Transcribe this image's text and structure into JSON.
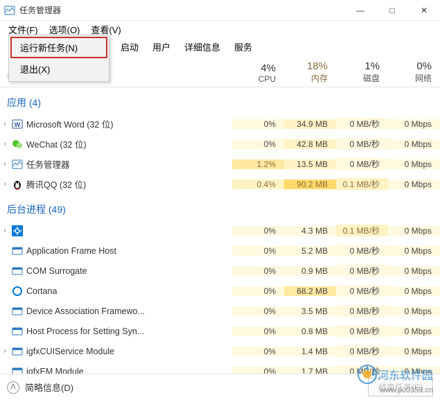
{
  "window": {
    "title": "任务管理器",
    "controls": {
      "minimize": "—",
      "maximize": "□",
      "close": "✕"
    }
  },
  "menu": {
    "file": "文件(F)",
    "options": "选项(O)",
    "view": "查看(V)"
  },
  "dropdown": {
    "new_task": "运行新任务(N)",
    "exit": "退出(X)"
  },
  "tabs": {
    "startup": "启动",
    "users": "用户",
    "details": "详细信息",
    "services": "服务"
  },
  "headers": {
    "name": "名称",
    "cpu_pct": "4%",
    "cpu_label": "CPU",
    "mem_pct": "18%",
    "mem_label": "内存",
    "disk_pct": "1%",
    "disk_label": "磁盘",
    "net_pct": "0%",
    "net_label": "网络"
  },
  "groups": {
    "apps": "应用 (4)",
    "bg": "后台进程 (49)"
  },
  "rows": [
    {
      "group": "apps",
      "expander": "›",
      "icon": "word",
      "name": "Microsoft Word (32 位)",
      "cpu": "0%",
      "mem": "34.9 MB",
      "disk": "0 MB/秒",
      "net": "0 Mbps",
      "cls": [
        "bg-yellow-1",
        "bg-yellow-2",
        "bg-yellow-1",
        "bg-yellow-1"
      ]
    },
    {
      "group": "apps",
      "expander": "›",
      "icon": "wechat",
      "name": "WeChat (32 位)",
      "cpu": "0%",
      "mem": "42.8 MB",
      "disk": "0 MB/秒",
      "net": "0 Mbps",
      "cls": [
        "bg-yellow-1",
        "bg-yellow-2",
        "bg-yellow-1",
        "bg-yellow-1"
      ]
    },
    {
      "group": "apps",
      "expander": "›",
      "icon": "taskmgr",
      "name": "任务管理器",
      "cpu": "1.2%",
      "mem": "13.5 MB",
      "disk": "0 MB/秒",
      "net": "0 Mbps",
      "cls": [
        "bg-yellow-3 s",
        "bg-yellow-2",
        "bg-yellow-1",
        "bg-yellow-1"
      ]
    },
    {
      "group": "apps",
      "expander": "›",
      "icon": "qq",
      "name": "腾讯QQ (32 位)",
      "cpu": "0.4%",
      "mem": "90.2 MB",
      "disk": "0.1 MB/秒",
      "net": "0 Mbps",
      "cls": [
        "bg-yellow-2 s",
        "bg-yellow-4 s",
        "bg-yellow-2 s",
        "bg-yellow-1"
      ]
    },
    {
      "group": "bg",
      "expander": "›",
      "icon": "gear",
      "name": "",
      "cpu": "0%",
      "mem": "4.3 MB",
      "disk": "0.1 MB/秒",
      "net": "0 Mbps",
      "cls": [
        "bg-yellow-1",
        "bg-yellow-1",
        "bg-yellow-2 s",
        "bg-yellow-1"
      ]
    },
    {
      "group": "bg",
      "expander": "",
      "icon": "winapp",
      "name": "Application Frame Host",
      "cpu": "0%",
      "mem": "5.2 MB",
      "disk": "0 MB/秒",
      "net": "0 Mbps",
      "cls": [
        "bg-yellow-1",
        "bg-yellow-1",
        "bg-yellow-1",
        "bg-yellow-1"
      ]
    },
    {
      "group": "bg",
      "expander": "",
      "icon": "winapp",
      "name": "COM Surrogate",
      "cpu": "0%",
      "mem": "0.9 MB",
      "disk": "0 MB/秒",
      "net": "0 Mbps",
      "cls": [
        "bg-yellow-1",
        "bg-yellow-1",
        "bg-yellow-1",
        "bg-yellow-1"
      ]
    },
    {
      "group": "bg",
      "expander": "",
      "icon": "cortana",
      "name": "Cortana",
      "cpu": "0%",
      "mem": "68.2 MB",
      "disk": "0 MB/秒",
      "net": "0 Mbps",
      "cls": [
        "bg-yellow-1",
        "bg-yellow-3",
        "bg-yellow-1",
        "bg-yellow-1"
      ]
    },
    {
      "group": "bg",
      "expander": "",
      "icon": "winapp",
      "name": "Device Association Framewo...",
      "cpu": "0%",
      "mem": "3.5 MB",
      "disk": "0 MB/秒",
      "net": "0 Mbps",
      "cls": [
        "bg-yellow-1",
        "bg-yellow-1",
        "bg-yellow-1",
        "bg-yellow-1"
      ]
    },
    {
      "group": "bg",
      "expander": "",
      "icon": "winapp",
      "name": "Host Process for Setting Syn...",
      "cpu": "0%",
      "mem": "0.8 MB",
      "disk": "0 MB/秒",
      "net": "0 Mbps",
      "cls": [
        "bg-yellow-1",
        "bg-yellow-1",
        "bg-yellow-1",
        "bg-yellow-1"
      ]
    },
    {
      "group": "bg",
      "expander": "›",
      "icon": "winapp",
      "name": "igfxCUIService Module",
      "cpu": "0%",
      "mem": "1.4 MB",
      "disk": "0 MB/秒",
      "net": "0 Mbps",
      "cls": [
        "bg-yellow-1",
        "bg-yellow-1",
        "bg-yellow-1",
        "bg-yellow-1"
      ]
    },
    {
      "group": "bg",
      "expander": "",
      "icon": "winapp",
      "name": "igfxEM Module",
      "cpu": "0%",
      "mem": "1.7 MB",
      "disk": "0 MB/秒",
      "net": "0 Mbps",
      "cls": [
        "bg-yellow-1",
        "bg-yellow-1",
        "bg-yellow-1",
        "bg-yellow-1"
      ]
    }
  ],
  "footer": {
    "brief": "简略信息(D)",
    "end_task": "结束任务(E)"
  },
  "watermark": {
    "text": "河东软件园",
    "url": "www.pc0359.cn"
  }
}
